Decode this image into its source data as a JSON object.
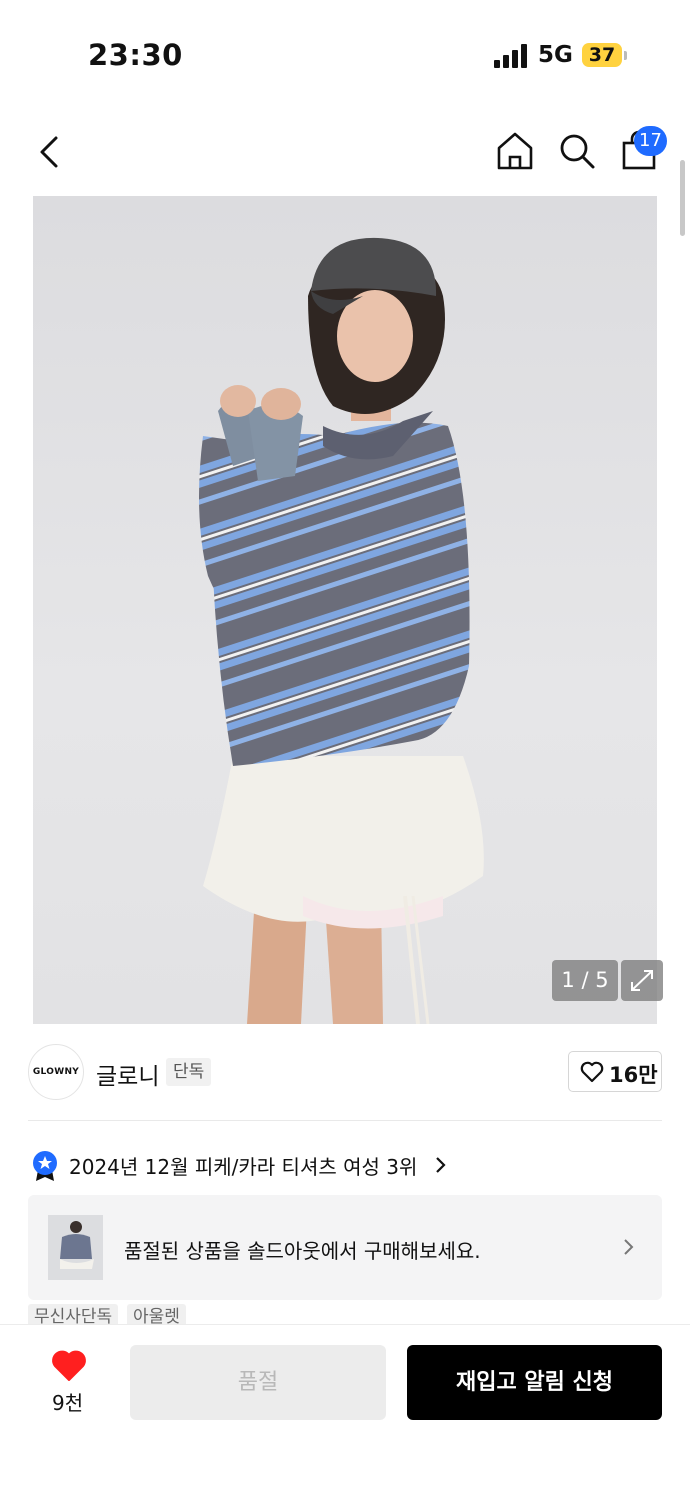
{
  "status_bar": {
    "time": "23:30",
    "network": "5G",
    "battery": "37"
  },
  "header": {
    "cart_count": "17"
  },
  "gallery": {
    "indicator": "1 / 5"
  },
  "brand": {
    "logo_text": "GLOWNY",
    "name": "글로니",
    "exclusive_label": "단독",
    "likes": "16만"
  },
  "ranking": {
    "text": "2024년 12월 피케/카라 티셔츠 여성 3위"
  },
  "soldout_banner": {
    "text": "품절된 상품을 솔드아웃에서 구매해보세요."
  },
  "tags": [
    "무신사단독",
    "아울렛"
  ],
  "bottom_bar": {
    "wish_count": "9천",
    "soldout_label": "품절",
    "restock_label": "재입고 알림 신청"
  },
  "colors": {
    "accent_blue": "#1f6bff",
    "heart_red": "#ff1f1f",
    "battery_yellow": "#ffd23f"
  }
}
